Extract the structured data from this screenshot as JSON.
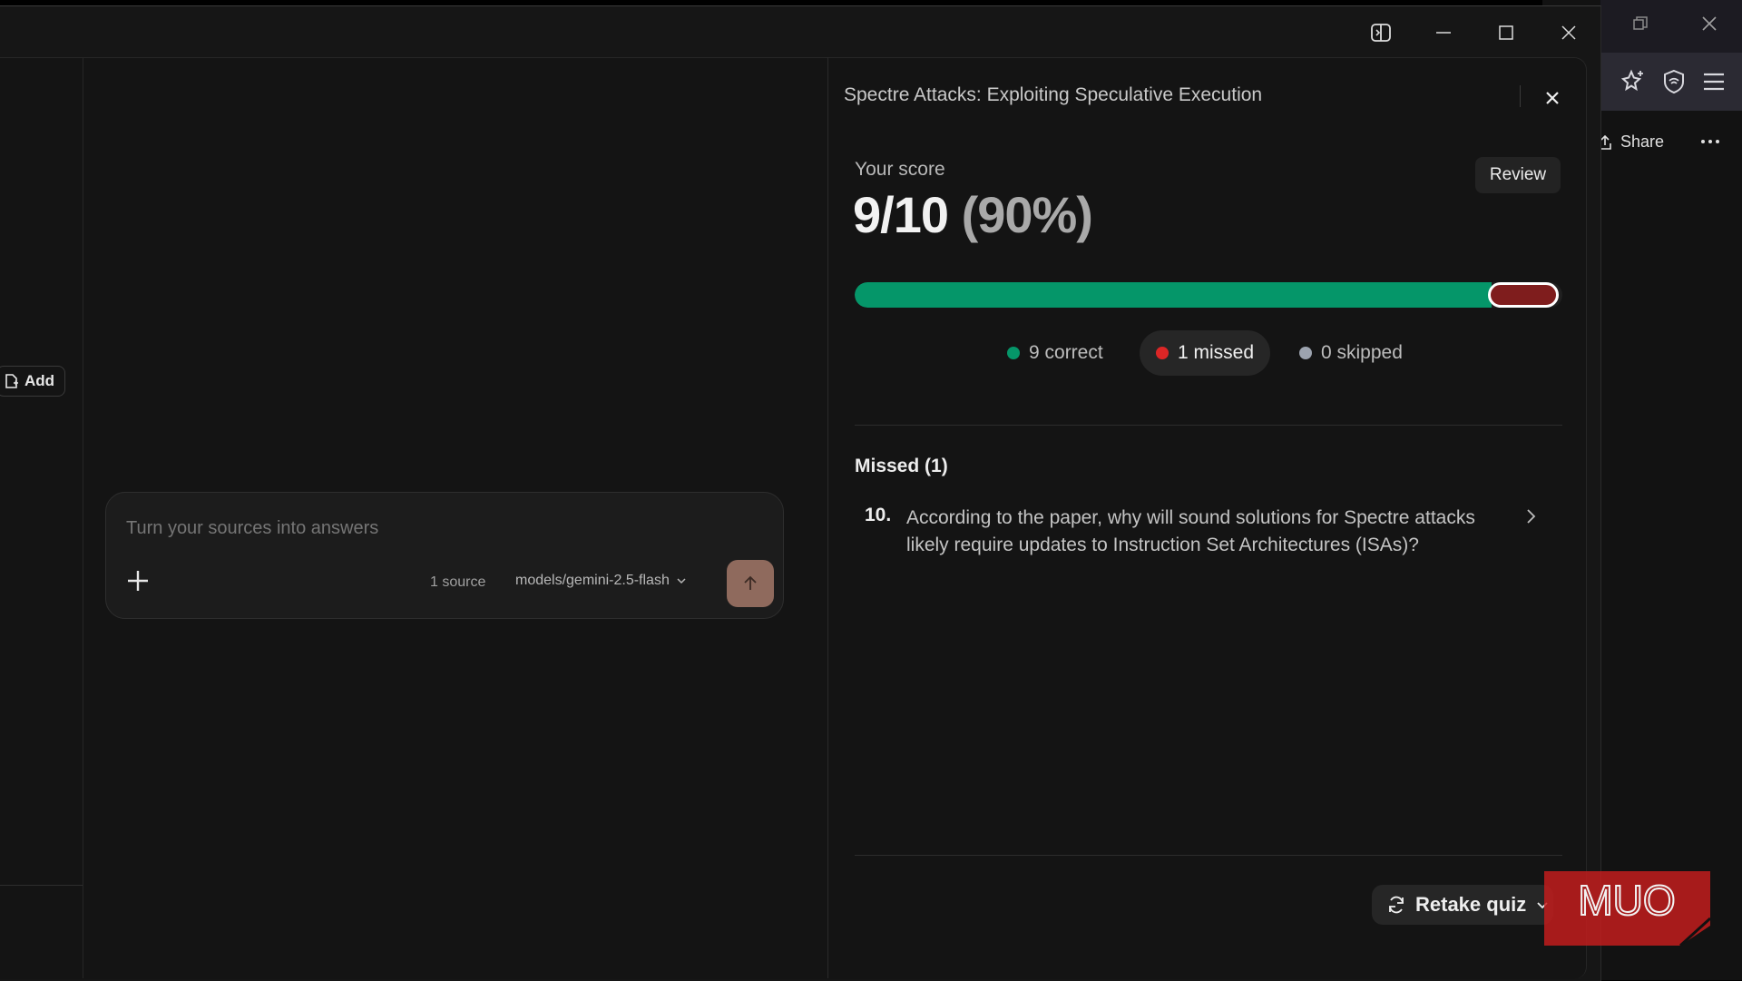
{
  "chat": {
    "add_label": "Add",
    "placeholder": "Turn your sources into answers",
    "source_count": "1 source",
    "model": "models/gemini-2.5-flash"
  },
  "quiz": {
    "title": "Spectre Attacks: Exploiting Speculative Execution",
    "score_label": "Your score",
    "score": "9/10",
    "score_percent": "(90%)",
    "review_label": "Review",
    "progress": {
      "correct": 9,
      "missed": 1,
      "total": 10
    },
    "legend": {
      "correct": "9 correct",
      "missed": "1 missed",
      "skipped": "0 skipped"
    },
    "missed_heading": "Missed (1)",
    "missed_items": [
      {
        "number": "10.",
        "text": "According to the paper, why will sound solutions for Spectre attacks likely require updates to Instruction Set Architectures (ISAs)?"
      }
    ],
    "retake_label": "Retake quiz"
  },
  "background_browser": {
    "share_label": "Share"
  },
  "colors": {
    "correct": "#059669",
    "missed": "#dc2626",
    "missed_bar": "#7f1d1d",
    "skipped": "#9ca3af",
    "send_button": "#8f6a5d",
    "watermark": "#c81d1d"
  },
  "icons": [
    "side-panel-icon",
    "minimize-icon",
    "maximize-icon",
    "close-icon",
    "restore-icon",
    "extensions-icon",
    "sparkle-star-icon",
    "shield-icon",
    "hamburger-menu-icon",
    "share-icon",
    "more-dots-icon",
    "add-source-icon",
    "plus-icon",
    "chevron-down-icon",
    "arrow-up-icon",
    "chevron-right-icon",
    "refresh-icon"
  ],
  "watermark": {
    "text": "MUO"
  }
}
